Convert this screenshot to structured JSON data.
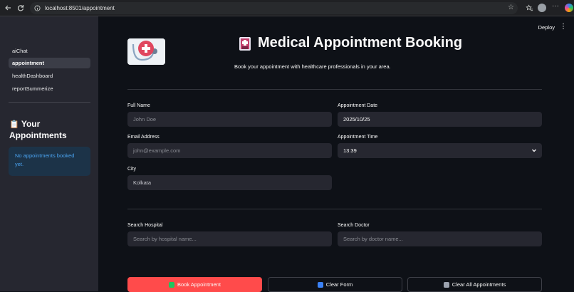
{
  "browser": {
    "url": "localhost:8501/appointment",
    "icons": [
      "back-arrow-icon",
      "reload-icon",
      "site-info-icon",
      "bookmark-star-icon",
      "favorites-icon",
      "profile-avatar",
      "more-menu-icon",
      "copilot-icon"
    ]
  },
  "sidebar": {
    "nav": [
      {
        "label": "aiChat",
        "active": false
      },
      {
        "label": "appointment",
        "active": true
      },
      {
        "label": "healthDashboard",
        "active": false
      },
      {
        "label": "reportSummerize",
        "active": false
      }
    ],
    "title_emoji": "📋",
    "title": "Your Appointments",
    "info_text": "No appointments booked yet."
  },
  "header": {
    "deploy_label": "Deploy",
    "title": "Medical Appointment Booking",
    "subtitle": "Book your appointment with healthcare professionals in your area."
  },
  "form": {
    "full_name": {
      "label": "Full Name",
      "placeholder": "John Doe"
    },
    "appointment_date": {
      "label": "Appointment Date",
      "value": "2025/10/25"
    },
    "email": {
      "label": "Email Address",
      "placeholder": "john@example.com"
    },
    "appointment_time": {
      "label": "Appointment Time",
      "value": "13:39"
    },
    "city": {
      "label": "City",
      "value": "Kolkata"
    }
  },
  "search": {
    "hospital": {
      "label": "Search Hospital",
      "placeholder": "Search by hospital name..."
    },
    "doctor": {
      "label": "Search Doctor",
      "placeholder": "Search by doctor name..."
    }
  },
  "actions": {
    "book": "Book Appointment",
    "clear_form": "Clear Form",
    "clear_all": "Clear All Appointments"
  },
  "colors": {
    "primary": "#ff4b4b",
    "background": "#0e1117",
    "sidebar": "#262730",
    "info_bg": "#1c3348",
    "info_text": "#4aa3f0"
  }
}
